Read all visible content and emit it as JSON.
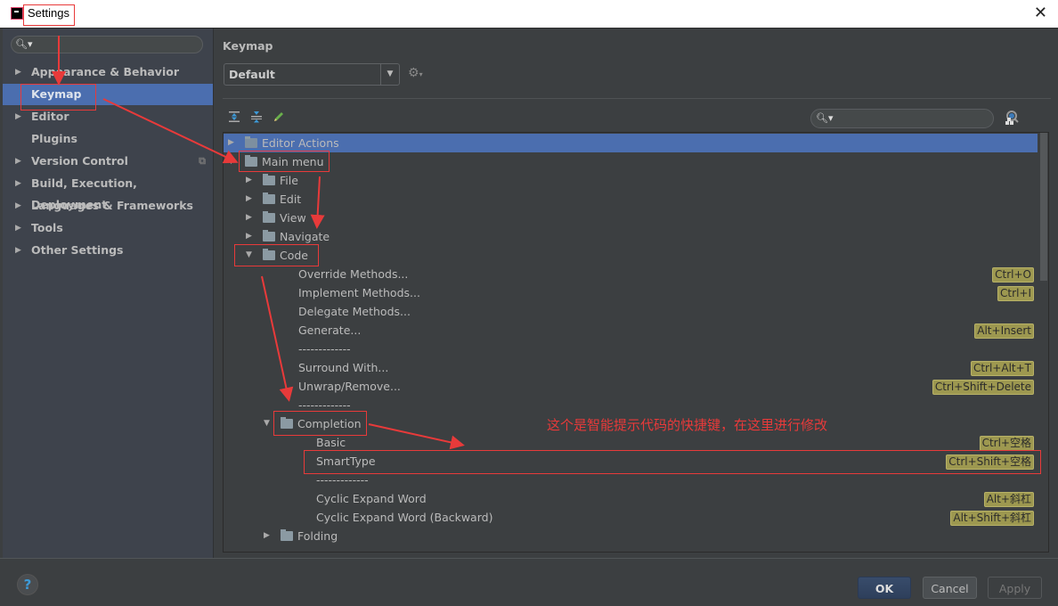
{
  "window": {
    "title": "Settings",
    "close_icon": "close-icon"
  },
  "sidebar": {
    "search_placeholder": "",
    "items": [
      {
        "label": "Appearance & Behavior",
        "expandable": true
      },
      {
        "label": "Keymap",
        "expandable": false,
        "selected": true
      },
      {
        "label": "Editor",
        "expandable": true
      },
      {
        "label": "Plugins",
        "expandable": false
      },
      {
        "label": "Version Control",
        "expandable": true,
        "project_icon": true
      },
      {
        "label": "Build, Execution, Deployment",
        "expandable": true
      },
      {
        "label": "Languages & Frameworks",
        "expandable": true
      },
      {
        "label": "Tools",
        "expandable": true
      },
      {
        "label": "Other Settings",
        "expandable": true
      }
    ]
  },
  "main": {
    "title": "Keymap",
    "keymap_select": "Default",
    "toolbar": {
      "expand_all": "expand-all-icon",
      "collapse_all": "collapse-all-icon",
      "edit": "pencil-icon"
    },
    "tree_search_placeholder": "",
    "tree": [
      {
        "label": "Editor Actions",
        "level": 0,
        "type": "editor-actions",
        "expanded": false,
        "selected": true
      },
      {
        "label": "Main menu",
        "level": 0,
        "type": "menu",
        "expanded": true
      },
      {
        "label": "File",
        "level": 1,
        "type": "folder",
        "expanded": false
      },
      {
        "label": "Edit",
        "level": 1,
        "type": "folder",
        "expanded": false
      },
      {
        "label": "View",
        "level": 1,
        "type": "folder",
        "expanded": false
      },
      {
        "label": "Navigate",
        "level": 1,
        "type": "folder",
        "expanded": false
      },
      {
        "label": "Code",
        "level": 1,
        "type": "folder",
        "expanded": true
      },
      {
        "label": "Override Methods...",
        "level": 2,
        "type": "action",
        "shortcut": "Ctrl+O"
      },
      {
        "label": "Implement Methods...",
        "level": 2,
        "type": "action",
        "shortcut": "Ctrl+I"
      },
      {
        "label": "Delegate Methods...",
        "level": 2,
        "type": "action"
      },
      {
        "label": "Generate...",
        "level": 2,
        "type": "action",
        "shortcut": "Alt+Insert"
      },
      {
        "label": "-------------",
        "level": 2,
        "type": "separator"
      },
      {
        "label": "Surround With...",
        "level": 2,
        "type": "action",
        "shortcut": "Ctrl+Alt+T"
      },
      {
        "label": "Unwrap/Remove...",
        "level": 2,
        "type": "action",
        "shortcut": "Ctrl+Shift+Delete"
      },
      {
        "label": "-------------",
        "level": 2,
        "type": "separator"
      },
      {
        "label": "Completion",
        "level": 2,
        "type": "folder",
        "expanded": true
      },
      {
        "label": "Basic",
        "level": 3,
        "type": "action",
        "shortcut": "Ctrl+空格"
      },
      {
        "label": "SmartType",
        "level": 3,
        "type": "action",
        "shortcut": "Ctrl+Shift+空格"
      },
      {
        "label": "-------------",
        "level": 3,
        "type": "separator"
      },
      {
        "label": "Cyclic Expand Word",
        "level": 3,
        "type": "action",
        "shortcut": "Alt+斜杠"
      },
      {
        "label": "Cyclic Expand Word (Backward)",
        "level": 3,
        "type": "action",
        "shortcut": "Alt+Shift+斜杠"
      },
      {
        "label": "Folding",
        "level": 2,
        "type": "folder",
        "expanded": false
      }
    ]
  },
  "annotation": {
    "note": "这个是智能提示代码的快捷键，在这里进行修改",
    "color": "#e83a3a"
  },
  "footer": {
    "help": "?",
    "ok": "OK",
    "cancel": "Cancel",
    "apply": "Apply"
  },
  "colors": {
    "selection": "#4b6eaf",
    "shortcut_bg": "#9d9850",
    "background": "#3c3f41",
    "sidebar_bg": "#3e434c"
  }
}
